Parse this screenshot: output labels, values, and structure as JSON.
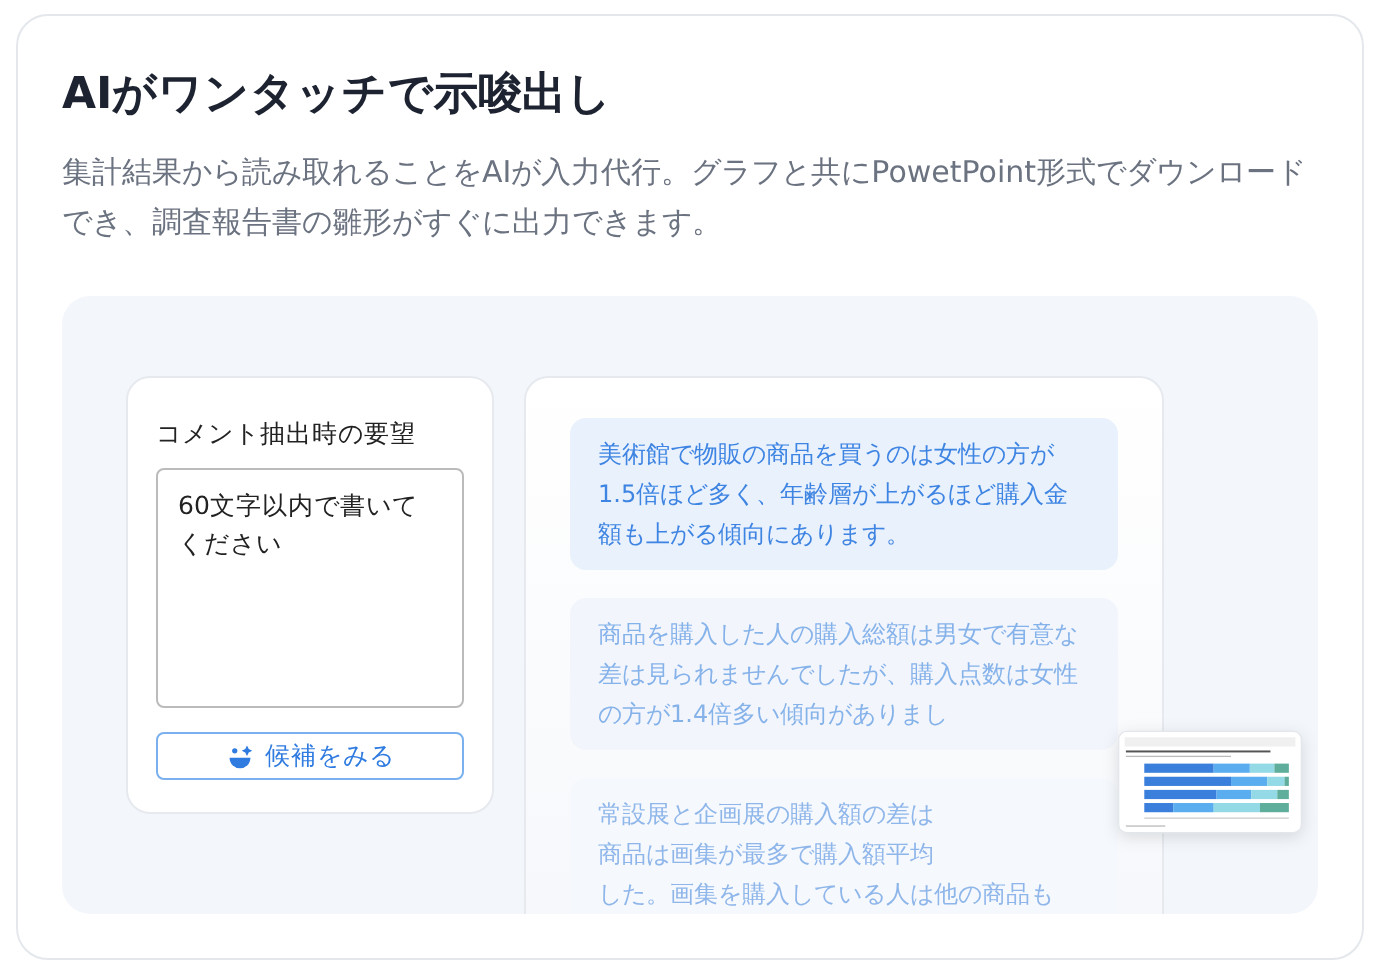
{
  "heading": "AIがワンタッチで示唆出し",
  "description": "集計結果から読み取れることをAIが入力代行。グラフと共にPowetPoint形式でダウンロードでき、調査報告書の雛形がすぐに出力できます。",
  "request_panel": {
    "label": "コメント抽出時の要望",
    "value": "60文字以内で書いてください",
    "button": "候補をみる"
  },
  "comments": [
    {
      "selected": true,
      "lines": [
        "美術館で物販の商品を買うのは女性の方が",
        "1.5倍ほど多く、年齢層が上がるほど購入金",
        "額も上がる傾向にあります。"
      ]
    },
    {
      "selected": false,
      "lines": [
        "商品を購入した人の購入総額は男女で有意な",
        "差は見られませんでしたが、購入点数は女性",
        "の方が1.4倍多い傾向がありまし"
      ]
    },
    {
      "selected": false,
      "lines": [
        "常設展と企画展の購入額の差は",
        "商品は画集が最多で購入額平均",
        "した。画集を購入している人は他の商品も"
      ]
    }
  ]
}
